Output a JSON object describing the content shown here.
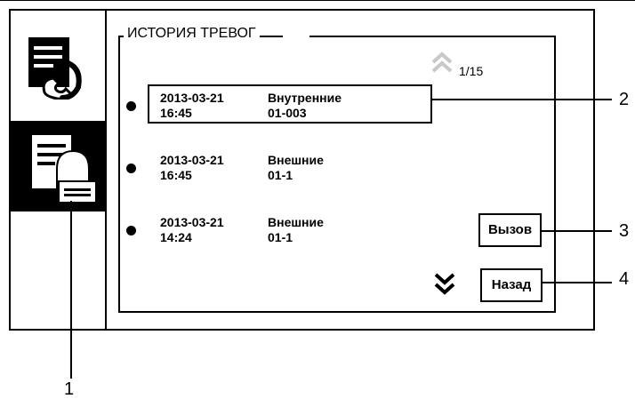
{
  "panel": {
    "title": "ИСТОРИЯ ТРЕВОГ",
    "page_indicator": "1/15"
  },
  "sidebar": {
    "items": [
      {
        "name": "intercom",
        "icon": "phone-log-icon",
        "selected": false
      },
      {
        "name": "alarm-history",
        "icon": "alarm-log-icon",
        "selected": true
      }
    ]
  },
  "alarms": [
    {
      "date": "2013-03-21",
      "time": "16:45",
      "type": "Внутренние",
      "code": "01-003",
      "selected": true
    },
    {
      "date": "2013-03-21",
      "time": "16:45",
      "type": "Внешние",
      "code": "01-1",
      "selected": false
    },
    {
      "date": "2013-03-21",
      "time": "14:24",
      "type": "Внешние",
      "code": "01-1",
      "selected": false
    }
  ],
  "buttons": {
    "call_label": "Вызов",
    "back_label": "Назад"
  },
  "icons": {
    "scroll_up": "double-chevron-up-icon",
    "scroll_down": "double-chevron-down-icon"
  },
  "callouts": [
    "1",
    "2",
    "3",
    "4"
  ],
  "colors": {
    "ink": "#000000",
    "disabled_arrow": "#c8c8c8",
    "background": "#ffffff"
  }
}
